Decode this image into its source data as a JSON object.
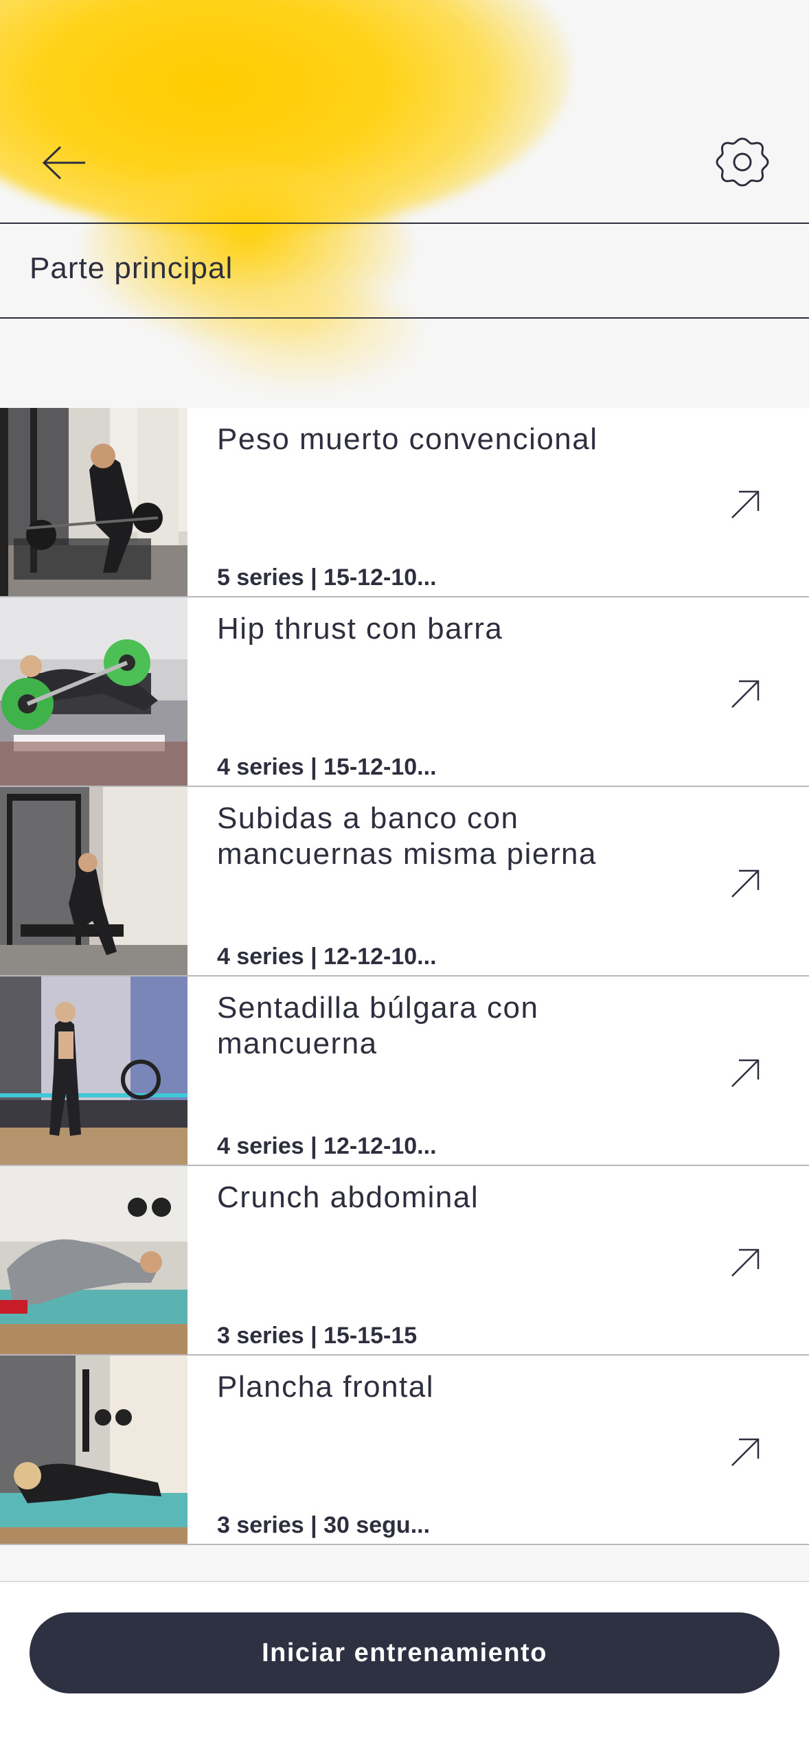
{
  "header": {
    "section_title": "Parte principal"
  },
  "icons": {
    "back": "arrow-left-icon",
    "settings": "gear-icon",
    "open": "arrow-up-right-icon"
  },
  "colors": {
    "accent_yellow": "#ffcc00",
    "dark": "#2e2f3e",
    "button_bg": "#2e3142",
    "button_text": "#ffffff"
  },
  "exercises": [
    {
      "title": "Peso muerto convencional",
      "meta": "5 series  | 15-12-10..."
    },
    {
      "title": "Hip thrust con barra",
      "meta": "4 series  | 15-12-10..."
    },
    {
      "title": "Subidas a banco con mancuernas misma pierna",
      "meta": "4 series  | 12-12-10..."
    },
    {
      "title": "Sentadilla búlgara con mancuerna",
      "meta": "4 series  | 12-12-10..."
    },
    {
      "title": "Crunch abdominal",
      "meta": "3 series  | 15-15-15"
    },
    {
      "title": "Plancha frontal",
      "meta": "3 series  | 30 segu..."
    }
  ],
  "footer": {
    "start_label": "Iniciar entrenamiento"
  }
}
